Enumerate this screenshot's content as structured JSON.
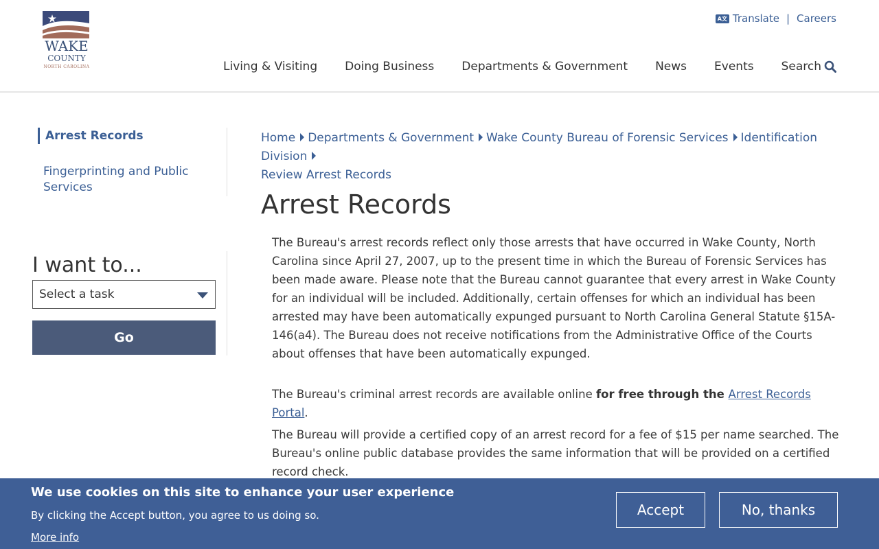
{
  "logo": {
    "line1": "WAKE",
    "line2": "COUNTY",
    "line3": "NORTH CAROLINA"
  },
  "utility": {
    "translate_icon": "translate-icon",
    "translate": "Translate",
    "separator": "|",
    "careers": "Careers"
  },
  "nav": {
    "items": [
      "Living & Visiting",
      "Doing Business",
      "Departments & Government",
      "News",
      "Events"
    ],
    "search": "Search",
    "search_icon": "search-icon"
  },
  "sidebar": {
    "active": "Arrest Records",
    "items": [
      "Fingerprinting and Public Services"
    ]
  },
  "iwant": {
    "title": "I want to...",
    "select_value": "Select a task",
    "go": "Go"
  },
  "breadcrumb": [
    "Home",
    "Departments & Government",
    "Wake County Bureau of Forensic Services",
    "Identification Division",
    "Review Arrest Records"
  ],
  "page": {
    "title": "Arrest Records",
    "p1": "The Bureau's arrest records reflect only those arrests that have occurred in Wake County, North Carolina since April 27, 2007, up to the present time in which the Bureau of Forensic Services has been made aware. Please note that the Bureau cannot guarantee that every arrest in Wake County for an individual will be included. Additionally, certain offenses for which an individual has been arrested may have been automatically expunged pursuant to North Carolina General Statute §15A-146(a4). The Bureau does not receive notifications from the Administrative Office of the Courts about offenses that have been automatically expunged.",
    "p2_start": "The Bureau's criminal arrest records are available online ",
    "p2_bold": "for free through the ",
    "p2_link": "Arrest Records Portal",
    "p2_end": ".",
    "p3": "The Bureau will provide a certified copy of an arrest record for a fee of $15 per name searched. The Bureau's online public database provides the same information that will be provided on a certified record check."
  },
  "cookie": {
    "title": "We use cookies on this site to enhance your user experience",
    "text": "By clicking the Accept button, you agree to us doing so.",
    "more": "More info",
    "accept": "Accept",
    "decline": "No, thanks"
  },
  "colors": {
    "link": "#3b5f95",
    "banner": "#3f5f96",
    "go_button": "#4b5b7a"
  }
}
